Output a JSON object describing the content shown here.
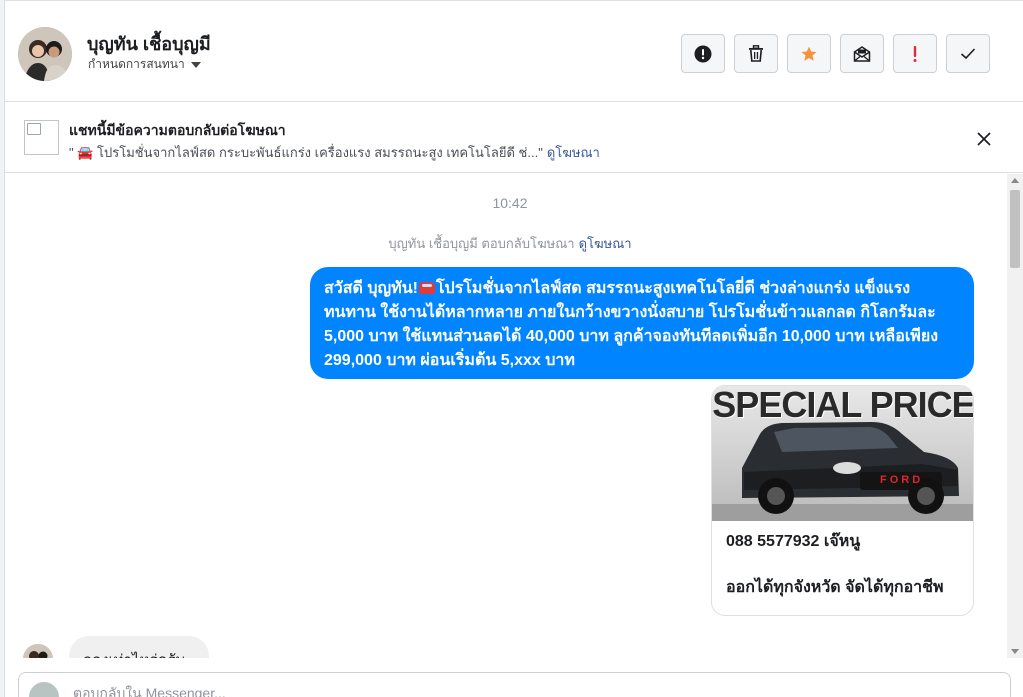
{
  "header": {
    "contact_name": "บุญทัน เชื้อบุญมี",
    "conversation_settings": "กำหนดการสนทนา",
    "toolbar": [
      {
        "name": "report-spam-button",
        "icon": "exclamation-circle-icon"
      },
      {
        "name": "delete-button",
        "icon": "trash-icon"
      },
      {
        "name": "star-button",
        "icon": "star-icon",
        "color": "#f7923b"
      },
      {
        "name": "mark-unread-button",
        "icon": "envelope-icon"
      },
      {
        "name": "follow-up-button",
        "icon": "exclamation-icon",
        "color": "#e02a3b"
      },
      {
        "name": "mark-done-button",
        "icon": "checkmark-icon"
      }
    ]
  },
  "ad_banner": {
    "title": "แชทนี้มีข้อความตอบกลับต่อโฆษณา",
    "text": "\" 🚘 โปรโมชั่นจากไลฟ์สด กระบะพันธ์แกร่ง เครื่องแรง สมรรถนะสูง เทคโนโลยีดี ช่...\"",
    "link": "ดูโฆษณา"
  },
  "chat": {
    "timestamp": "10:42",
    "reply_note": "บุญทัน เชื้อบุญมี ตอบกลับโฆษณา",
    "reply_note_link": "ดูโฆษณา",
    "outgoing_message": {
      "before_emoji": "สวัสดี บุญทัน!",
      "after_emoji": "โปรโมชั่นจากไลฟ์สด สมรรถนะสูงเทคโนโลยี่ดี ช่วงล่างแกร่ง แข็งแรง ทนทาน ใช้งานได้หลากหลาย ภายในกว้างขวางนั่งสบาย โปรโมชั่นข้าวแลกลด กิโลกรัมละ 5,000 บาท ใช้แทนส่วนลดได้ 40,000 บาท ลูกค้าจองทันทีลดเพิ่มอีก 10,000 บาท เหลือเพียง 299,000 บาท ผ่อนเริ่มต้น 5,xxx บาท"
    },
    "image_card": {
      "headline": "SPECIAL PRICE",
      "grille_text": "FORD",
      "line1": "088 5577932 เจ๊หนู",
      "line2": "ออกได้ทุกจังหวัด จัดได้ทุกอาชีพ"
    },
    "incoming_message": "ลองเท่าไหร่ครับ"
  },
  "composer": {
    "placeholder": "ตอบกลับใน Messenger..."
  }
}
